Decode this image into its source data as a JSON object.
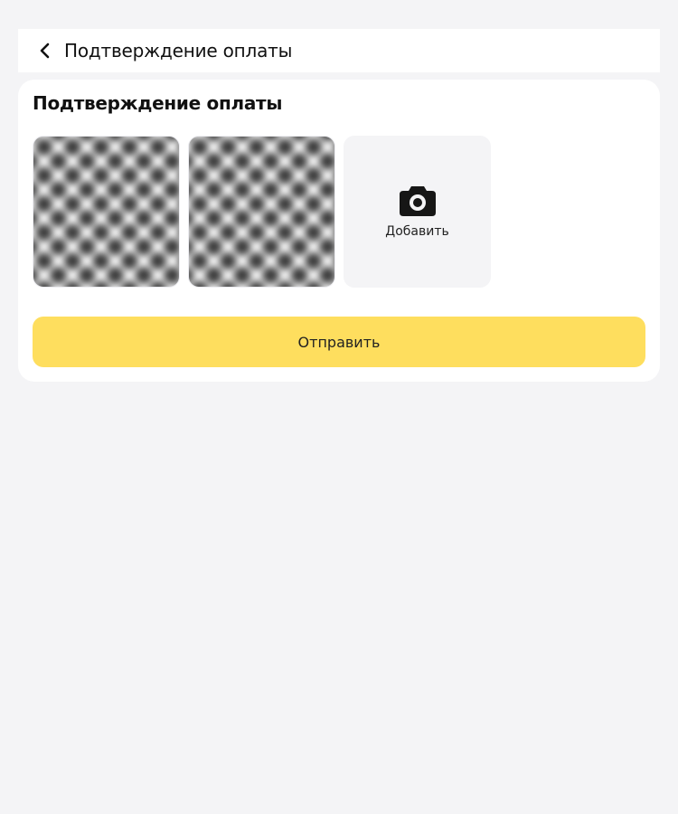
{
  "header": {
    "title": "Подтверждение оплаты",
    "back_icon": "chevron-left-icon"
  },
  "card": {
    "title": "Подтверждение оплаты",
    "photos": [
      {
        "kind": "uploaded-image"
      },
      {
        "kind": "uploaded-image"
      }
    ],
    "add_tile": {
      "icon": "camera-icon",
      "label": "Добавить"
    },
    "submit_label": "Отправить"
  },
  "colors": {
    "page_background": "#f4f4f6",
    "card_background": "#ffffff",
    "accent_button": "#fede5e",
    "add_tile_background": "#f4f4f6"
  }
}
